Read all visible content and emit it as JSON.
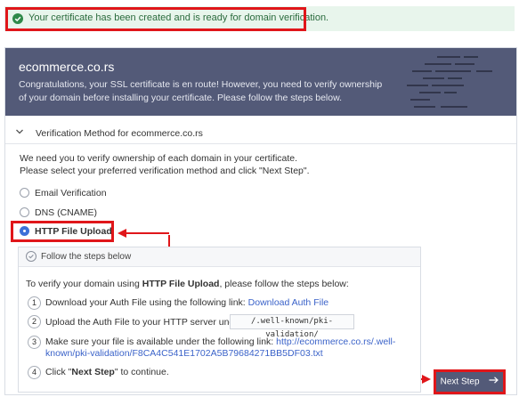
{
  "alert": {
    "message": "Your certificate has been created and is ready for domain verification."
  },
  "header": {
    "domain": "ecommerce.co.rs",
    "description": "Congratulations, your SSL certificate is en route! However, you need to verify ownership of your domain before installing your certificate. Please follow the steps below."
  },
  "verification": {
    "section_title": "Verification Method for ecommerce.co.rs",
    "intro_line1": "We need you to verify ownership of each domain in your certificate.",
    "intro_line2": "Please select your preferred verification method and click \"Next Step\".",
    "options": [
      {
        "label": "Email Verification",
        "selected": false
      },
      {
        "label": "DNS (CNAME)",
        "selected": false
      },
      {
        "label": "HTTP File Upload",
        "selected": true
      }
    ]
  },
  "steps": {
    "header": "Follow the steps below",
    "intro_prefix": "To verify your domain using ",
    "intro_method": "HTTP File Upload",
    "intro_suffix": ", please follow the steps below:",
    "items": [
      {
        "num": "1",
        "text": "Download your Auth File using the following link:",
        "link": "Download Auth File"
      },
      {
        "num": "2",
        "text": "Upload the Auth File to your HTTP server under:",
        "code": "/.well-known/pki-validation/"
      },
      {
        "num": "3",
        "text": "Make sure your file is available under the following link:",
        "link_line1": "http://ecommerce.co.rs/.well-",
        "link_line2": "known/pki-validation/F8CA4C541E1702A5B79684271BB5DF03.txt"
      },
      {
        "num": "4",
        "text_prefix": "Click \"",
        "text_bold": "Next Step",
        "text_suffix": "\" to continue."
      }
    ]
  },
  "next_button": {
    "label": "Next Step",
    "icon": "arrow-right-icon"
  },
  "colors": {
    "accent": "#535a78",
    "annotation": "#e0161a",
    "success_bg": "#e8f5ec",
    "link": "#3b63c9",
    "radio_selected": "#3d71d8"
  }
}
